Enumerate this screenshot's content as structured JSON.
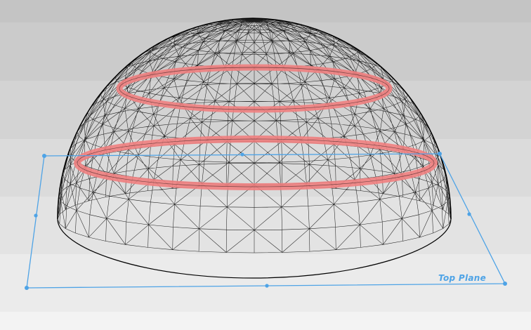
{
  "viewport": {
    "model": "hemisphere-mesh",
    "mesh_color": "#000000",
    "highlight_color": "#f08080",
    "plane_color": "#4ea3e6"
  },
  "reference_plane": {
    "label": "Top Plane"
  },
  "selected_edges": {
    "count": 2,
    "icon": "edge-loop-highlight"
  }
}
